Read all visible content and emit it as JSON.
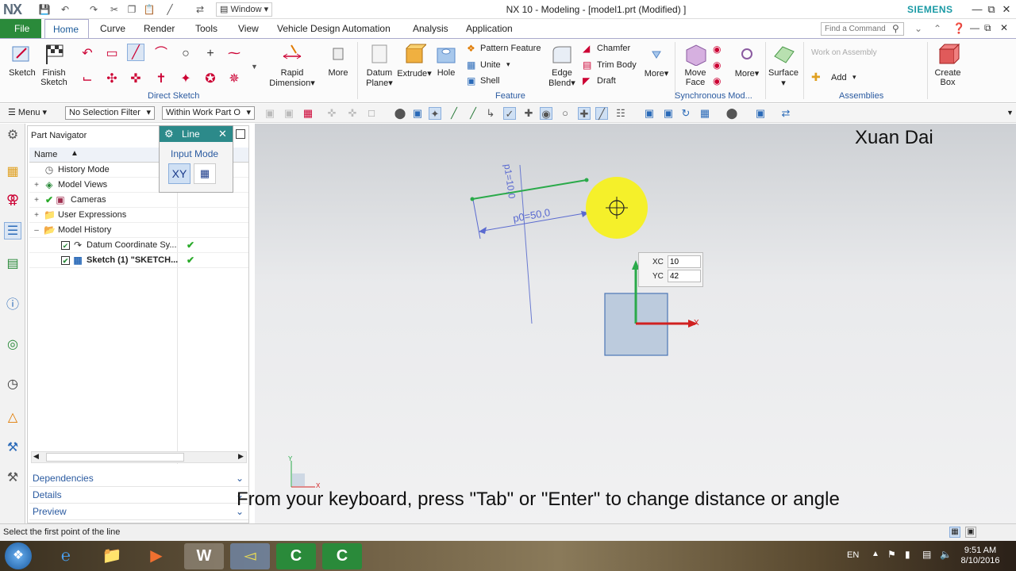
{
  "window": {
    "logo": "NX",
    "window_menu": "Window",
    "title": "NX 10 - Modeling - [model1.prt (Modified) ]",
    "brand": "SIEMENS"
  },
  "ribbon_tabs": [
    "File",
    "Home",
    "Curve",
    "Render",
    "Tools",
    "View",
    "Vehicle Design Automation",
    "Analysis",
    "Application"
  ],
  "find_command_placeholder": "Find a Command",
  "ribbon": {
    "sketch": "Sketch",
    "finish_sketch_1": "Finish",
    "finish_sketch_2": "Sketch",
    "rapid_dimension_1": "Rapid",
    "rapid_dimension_2": "Dimension",
    "more1": "More",
    "direct_sketch_group": "Direct Sketch",
    "datum_plane_1": "Datum",
    "datum_plane_2": "Plane",
    "extrude": "Extrude",
    "hole": "Hole",
    "pattern_feature": "Pattern Feature",
    "unite": "Unite",
    "shell": "Shell",
    "edge_blend_1": "Edge",
    "edge_blend_2": "Blend",
    "chamfer": "Chamfer",
    "trim_body": "Trim Body",
    "draft": "Draft",
    "more2": "More",
    "feature_group": "Feature",
    "move_face_1": "Move",
    "move_face_2": "Face",
    "more3": "More",
    "sync_group": "Synchronous Mod...",
    "surface": "Surface",
    "work_on_assembly": "Work on Assembly",
    "add": "Add",
    "assemblies_group": "Assemblies",
    "create_box_1": "Create",
    "create_box_2": "Box"
  },
  "selection_bar": {
    "menu": "Menu",
    "selection_filter": "No Selection Filter",
    "scope": "Within Work Part O"
  },
  "part_navigator": {
    "title": "Part Navigator",
    "column_name": "Name",
    "rows": [
      {
        "label": "History Mode"
      },
      {
        "label": "Model Views"
      },
      {
        "label": "Cameras"
      },
      {
        "label": "User Expressions"
      },
      {
        "label": "Model History"
      },
      {
        "label": "Datum Coordinate Sy..."
      },
      {
        "label": "Sketch (1) \"SKETCH..."
      }
    ],
    "panels": [
      "Dependencies",
      "Details",
      "Preview"
    ]
  },
  "line_dialog": {
    "title": "Line",
    "section": "Input Mode",
    "mode_xy": "XY"
  },
  "graphics": {
    "dim_p1": "p1=10,0",
    "dim_p0": "p0=50,0",
    "xc_label": "XC",
    "xc_value": "10",
    "yc_label": "YC",
    "yc_value": "42",
    "x_axis": "X",
    "y_axis": "Y",
    "watermark": "Xuan Dai",
    "subtitle": "From your keyboard, press \"Tab\" or \"Enter\" to change distance or angle"
  },
  "status_text": "Select the first point of the line",
  "taskbar": {
    "language": "EN",
    "time": "9:51 AM",
    "date": "8/10/2016"
  },
  "colors": {
    "file_tab": "#2a8a3a",
    "accent_blue": "#2a5aa0",
    "dialog_title": "#2c8a8a",
    "sketch_line": "#2aaa4a",
    "dimension": "#5a6ad0",
    "cursor_highlight": "#f5f02a"
  }
}
